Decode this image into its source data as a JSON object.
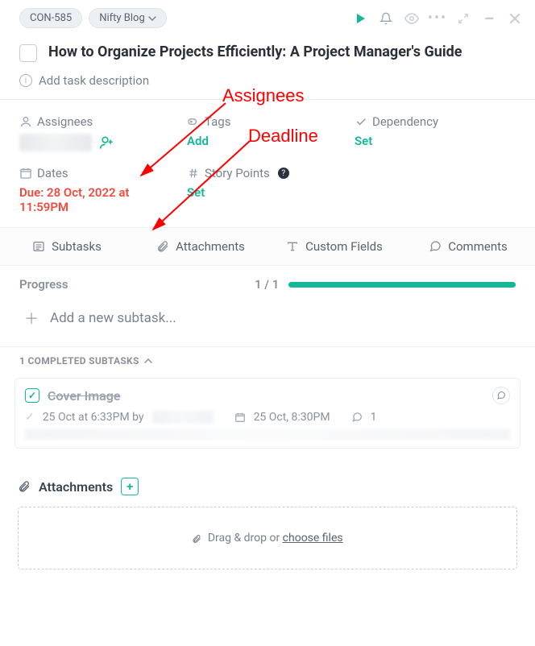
{
  "header": {
    "con_id": "CON-585",
    "project_pill": "Nifty Blog"
  },
  "task": {
    "title": "How to Organize Projects Efficiently: A Project Manager's Guide",
    "description_placeholder": "Add task description"
  },
  "fields": {
    "assignees": {
      "label": "Assignees"
    },
    "tags": {
      "label": "Tags",
      "action": "Add"
    },
    "dependency": {
      "label": "Dependency",
      "action": "Set"
    },
    "dates": {
      "label": "Dates",
      "value": "Due: 28 Oct, 2022 at 11:59PM"
    },
    "story_points": {
      "label": "Story Points",
      "action": "Set"
    }
  },
  "tabs": {
    "subtasks": "Subtasks",
    "attachments": "Attachments",
    "custom_fields": "Custom Fields",
    "comments": "Comments"
  },
  "progress": {
    "label": "Progress",
    "count": "1 / 1"
  },
  "add_subtask": "Add a new subtask...",
  "completed_toggle": "1 COMPLETED SUBTASKS",
  "subtask": {
    "title": "Cover Image",
    "completed_at": "25 Oct at 6:33PM by",
    "due": "25 Oct, 8:30PM",
    "comment_count": "1"
  },
  "attachments": {
    "label": "Attachments",
    "drop_prefix": "Drag & drop or ",
    "drop_link": "choose files"
  },
  "annotations": {
    "assignees_label": "Assignees",
    "deadline_label": "Deadline"
  }
}
